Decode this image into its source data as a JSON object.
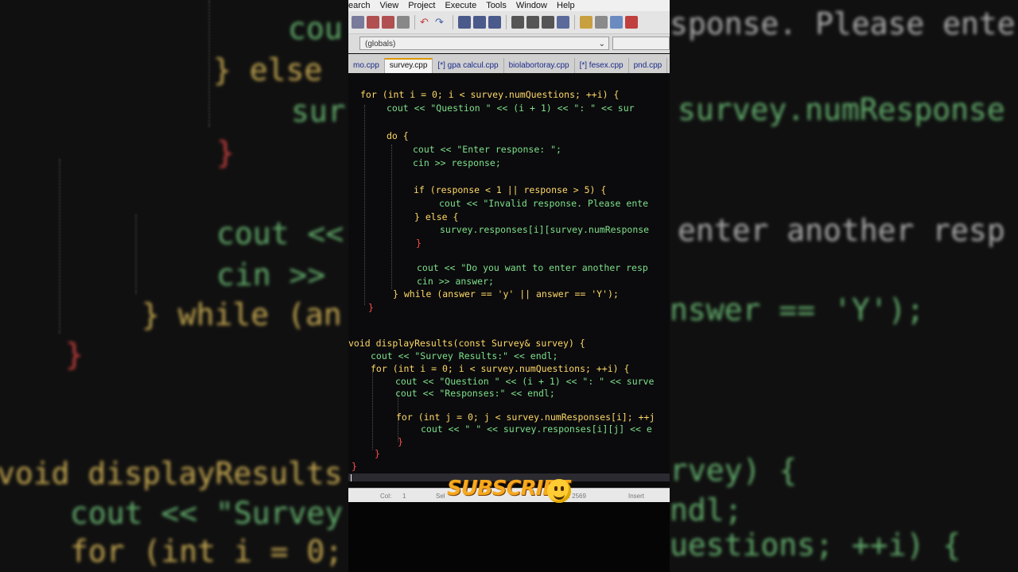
{
  "menu": [
    "earch",
    "View",
    "Project",
    "Execute",
    "Tools",
    "Window",
    "Help"
  ],
  "scope": {
    "value": "(globals)"
  },
  "tabs": [
    {
      "label": "mo.cpp"
    },
    {
      "label": "survey.cpp",
      "active": true
    },
    {
      "label": "[*] gpa calcul.cpp"
    },
    {
      "label": "biolabortoray.cpp"
    },
    {
      "label": "[*] fesex.cpp"
    },
    {
      "label": "pnd.cpp"
    }
  ],
  "code": {
    "l1": "for (int i = 0; i < survey.numQuestions; ++i) {",
    "l2": "cout << \"Question \" << (i + 1) << \": \" << sur",
    "l3": "do {",
    "l4": "cout << \"Enter response: \";",
    "l5": "cin >> response;",
    "l6": "if (response < 1 || response > 5) {",
    "l7": "cout << \"Invalid response. Please ente",
    "l8": "} else {",
    "l9": "survey.responses[i][survey.numResponse",
    "l10": "}",
    "l11": "cout << \"Do you want to enter another resp",
    "l12": "cin >> answer;",
    "l13": "} while (answer == 'y' || answer == 'Y');",
    "l14": "}",
    "l15": "void displayResults(const Survey& survey) {",
    "l16": "cout << \"Survey Results:\" << endl;",
    "l17": "for (int i = 0; i < survey.numQuestions; ++i) {",
    "l18": "cout << \"Question \" << (i + 1) << \": \" << surve",
    "l19": "cout << \"Responses:\" << endl;",
    "l20": "for (int j = 0; j < survey.numResponses[i]; ++j",
    "l21": "cout << \" \" << survey.responses[i][j] << e",
    "l22": "}",
    "l23": "}",
    "l24": "}"
  },
  "background_code": {
    "b1": "cou",
    "b2": "} else",
    "b3": "sur",
    "b4": "}",
    "b5": "cout <<",
    "b6": "cin >>",
    "b7": "} while (an",
    "b8": "}",
    "b9": "void displayResults",
    "b10": "cout << \"Survey",
    "b11": "for (int i = 0;",
    "r1": "sponse. Please ente",
    "r2": "survey.numResponse",
    "r3": "enter another resp",
    "r4": "nswer == 'Y');",
    "r5": "rvey) {",
    "r6": "ndl;",
    "r7": "uestions; ++i) {"
  },
  "status": {
    "col_label": "Col:",
    "col_value": "1",
    "sel_label": "Sel",
    "length": "th: 2569",
    "mode": "Insert"
  },
  "overlay": {
    "subscribe": "SUBSCRIBE"
  }
}
